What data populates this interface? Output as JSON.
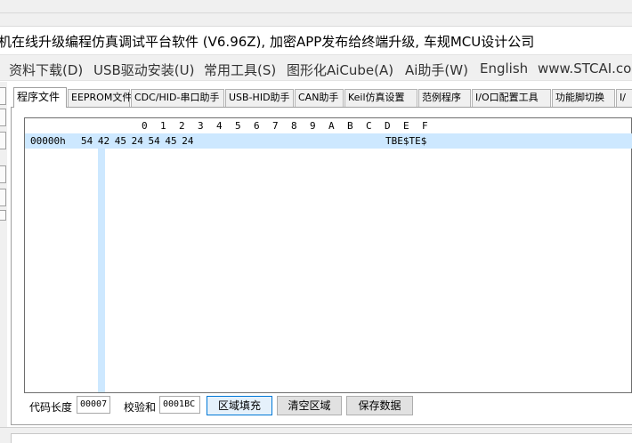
{
  "title": "机在线升级编程仿真调试平台软件 (V6.96Z), 加密APP发布给终端升级, 车规MCU设计公司",
  "menu": {
    "items": [
      "资料下载(D)",
      "USB驱动安装(U)",
      "常用工具(S)",
      "图形化AiCube(A)",
      "Ai助手(W)",
      "English",
      "www.STCAI.co"
    ]
  },
  "tabs": [
    {
      "label": "程序文件",
      "active": true
    },
    {
      "label": "EEPROM文件",
      "active": false
    },
    {
      "label": "CDC/HID-串口助手",
      "active": false
    },
    {
      "label": "USB-HID助手",
      "active": false
    },
    {
      "label": "CAN助手",
      "active": false
    },
    {
      "label": "Keil仿真设置",
      "active": false
    },
    {
      "label": "范例程序",
      "active": false
    },
    {
      "label": "I/O口配置工具",
      "active": false
    },
    {
      "label": "功能脚切换",
      "active": false
    },
    {
      "label": "I/",
      "active": false
    }
  ],
  "hex": {
    "columns": [
      "0",
      "1",
      "2",
      "3",
      "4",
      "5",
      "6",
      "7",
      "8",
      "9",
      "A",
      "B",
      "C",
      "D",
      "E",
      "F"
    ],
    "rows": [
      {
        "address": "00000h",
        "bytes": "54 42 45 24 54 45 24",
        "ascii": "TBE$TE$"
      }
    ]
  },
  "footer": {
    "code_length_label": "代码长度",
    "code_length_value": "00007",
    "checksum_label": "校验和",
    "checksum_value": "0001BC",
    "fill_button": "区域填充",
    "clear_button": "清空区域",
    "save_button": "保存数据"
  }
}
